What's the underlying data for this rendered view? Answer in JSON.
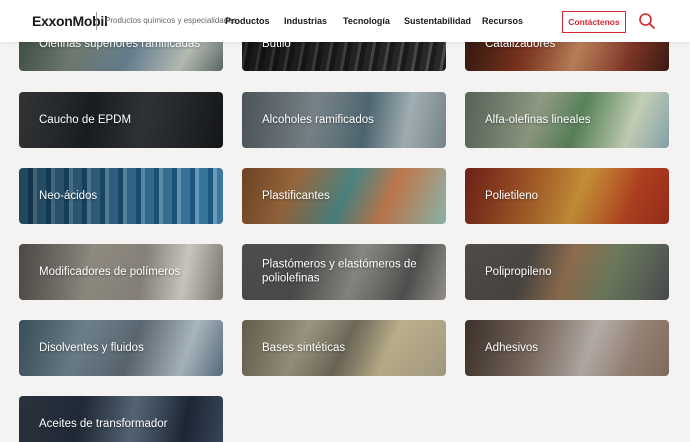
{
  "header": {
    "logo": "ExxonMobil",
    "tagline": "Productos químicos y especialidades",
    "nav": [
      "Productos",
      "Industrias",
      "Tecnología",
      "Sustentabilidad",
      "Recursos"
    ],
    "contact_label": "Contáctenos"
  },
  "tiles": [
    "Olefinas superiores ramificadas",
    "Butilo",
    "Catalizadores",
    "Caucho de EPDM",
    "Alcoholes ramificados",
    "Alfa-olefinas lineales",
    "Neo-ácidos",
    "Plastificantes",
    "Polietileno",
    "Modificadores de polímeros",
    "Plastómeros y elastómeros de poliolefinas",
    "Polipropileno",
    "Disolventes y fluidos",
    "Bases sintéticas",
    "Adhesivos",
    "Aceites de transformador"
  ],
  "colors": {
    "brand_red": "#d8262d",
    "page_bg": "#f4f3f1"
  }
}
